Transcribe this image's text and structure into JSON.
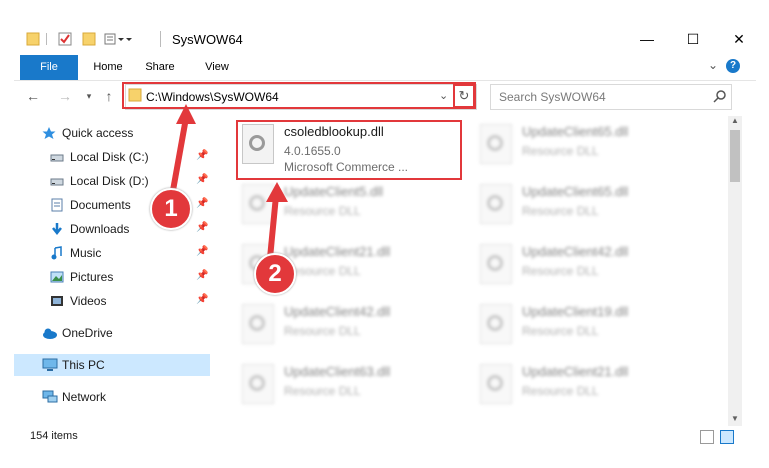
{
  "window": {
    "title": "SysWOW64",
    "controls": {
      "minimize": "—",
      "maximize": "☐",
      "close": "✕"
    }
  },
  "ribbon": {
    "tabs": [
      "File",
      "Home",
      "Share",
      "View"
    ],
    "help": "?",
    "expand": "⌄"
  },
  "address": {
    "path": "C:\\Windows\\SysWOW64",
    "search_placeholder": "Search SysWOW64"
  },
  "sidebar": {
    "items": [
      {
        "label": "Quick access",
        "icon": "star-icon"
      },
      {
        "label": "Local Disk (C:)",
        "icon": "drive-icon",
        "pinned": true
      },
      {
        "label": "Local Disk (D:)",
        "icon": "drive-icon",
        "pinned": true
      },
      {
        "label": "Documents",
        "icon": "documents-icon",
        "pinned": true
      },
      {
        "label": "Downloads",
        "icon": "download-icon",
        "pinned": true
      },
      {
        "label": "Music",
        "icon": "music-icon",
        "pinned": true
      },
      {
        "label": "Pictures",
        "icon": "pictures-icon",
        "pinned": true
      },
      {
        "label": "Videos",
        "icon": "videos-icon",
        "pinned": true
      },
      {
        "label": "OneDrive",
        "icon": "cloud-icon"
      },
      {
        "label": "This PC",
        "icon": "computer-icon",
        "selected": true
      },
      {
        "label": "Network",
        "icon": "network-icon"
      }
    ]
  },
  "files": [
    {
      "name": "csoledblookup.dll",
      "line2": "4.0.1655.0",
      "line3": "Microsoft Commerce ...",
      "highlighted": true
    },
    {
      "name": "UpdateClient65.dll",
      "line2": "Resource DLL"
    },
    {
      "name": "UpdateClient5.dll",
      "line2": "Resource DLL"
    },
    {
      "name": "UpdateClient65.dll",
      "line2": "Resource DLL"
    },
    {
      "name": "UpdateClient21.dll",
      "line2": "Resource DLL"
    },
    {
      "name": "UpdateClient42.dll",
      "line2": "Resource DLL"
    },
    {
      "name": "UpdateClient42.dll",
      "line2": "Resource DLL"
    },
    {
      "name": "UpdateClient19.dll",
      "line2": "Resource DLL"
    },
    {
      "name": "UpdateClient63.dll",
      "line2": "Resource DLL"
    },
    {
      "name": "UpdateClient21.dll",
      "line2": "Resource DLL"
    }
  ],
  "status": {
    "item_count": "154 items"
  },
  "callouts": [
    "1",
    "2"
  ],
  "colors": {
    "accent": "#1979ca",
    "highlight": "#e2383b",
    "selected_bg": "#cce8ff"
  }
}
